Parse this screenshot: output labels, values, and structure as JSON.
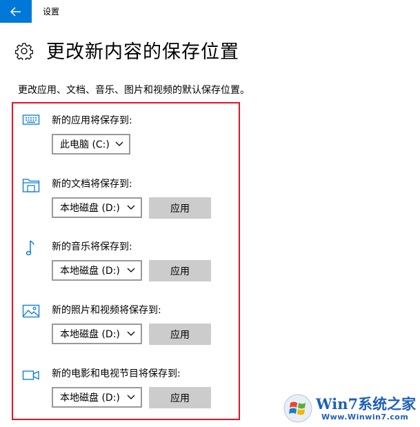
{
  "titlebar": {
    "title": "设置"
  },
  "header": {
    "title": "更改新内容的保存位置"
  },
  "description": "更改应用、文档、音乐、图片和视频的默认保存位置。",
  "sections": [
    {
      "label": "新的应用将保存到:",
      "icon": "monitor-icon",
      "dropdown": "此电脑 (C:)"
    },
    {
      "label": "新的文档将保存到:",
      "icon": "folder-icon",
      "dropdown": "本地磁盘 (D:)",
      "apply": "应用"
    },
    {
      "label": "新的音乐将保存到:",
      "icon": "music-note-icon",
      "dropdown": "本地磁盘 (D:)",
      "apply": "应用"
    },
    {
      "label": "新的照片和视频将保存到:",
      "icon": "picture-icon",
      "dropdown": "本地磁盘 (D:)",
      "apply": "应用"
    },
    {
      "label": "新的电影和电视节目将保存到:",
      "icon": "video-camera-icon",
      "dropdown": "本地磁盘 (D:)",
      "apply": "应用"
    }
  ],
  "watermark": {
    "line1": "Win7系统之家",
    "line2": "Www.Winwin7.com"
  },
  "colors": {
    "accent": "#0078d7",
    "highlight": "#e81123",
    "button": "#cccccc"
  }
}
